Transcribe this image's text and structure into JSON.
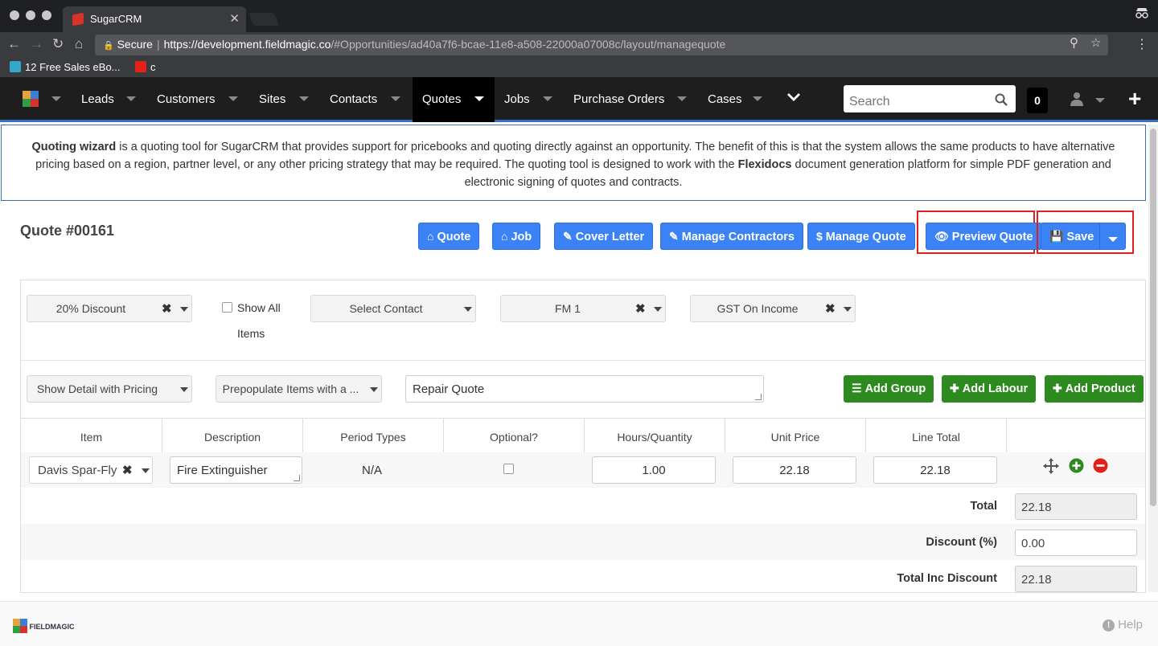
{
  "browser": {
    "tab_title": "SugarCRM",
    "tab_close": "✕",
    "omnibox": {
      "secure_label": "Secure",
      "separator": "|",
      "host": "https://development.fieldmagic.co",
      "path": "/#Opportunities/ad40a7f6-bcae-11e8-a508-22000a07008c/layout/managequote"
    },
    "bookmarks": [
      {
        "label": "12 Free Sales eBo...",
        "icon": "bookmark-icon",
        "color": "#35a7c9"
      },
      {
        "label": "c",
        "icon": "youtube-icon",
        "color": "#e62117"
      }
    ]
  },
  "navbar": {
    "items": [
      {
        "label": "Leads"
      },
      {
        "label": "Customers"
      },
      {
        "label": "Sites"
      },
      {
        "label": "Contacts"
      },
      {
        "label": "Quotes",
        "active": true
      },
      {
        "label": "Jobs"
      },
      {
        "label": "Purchase Orders"
      },
      {
        "label": "Cases"
      }
    ],
    "search_placeholder": "Search",
    "notification_count": "0",
    "accent_color": "#3a6fbf"
  },
  "banner": {
    "part1_bold": "Quoting wizard",
    "part1": " is a quoting tool for SugarCRM that provides support for pricebooks and quoting directly against an opportunity. The benefit of this is that the system allows the same products to have alternative pricing based on a region, partner level, or any other pricing strategy that may be required. The quoting tool is designed to work with the ",
    "part2_bold": "Flexidocs",
    "part2": " document generation platform for simple PDF generation and electronic signing of quotes and contracts."
  },
  "quote": {
    "title": "Quote #00161",
    "actions": {
      "quote": "Quote",
      "job": "Job",
      "cover_letter": "Cover Letter",
      "manage_contractors": "Manage Contractors",
      "manage_quote": "Manage Quote",
      "preview_quote": "Preview Quote",
      "save": "Save"
    },
    "filters": {
      "discount": "20% Discount",
      "show_all_items_line1": "Show All",
      "show_all_items_line2": "Items",
      "contact": "Select Contact",
      "fm": "FM 1",
      "tax": "GST On Income",
      "detail": "Show Detail with Pricing",
      "prepopulate": "Prepopulate Items with a ...",
      "quote_name": "Repair Quote"
    },
    "add_buttons": {
      "group": "Add Group",
      "labour": "Add Labour",
      "product": "Add Product"
    },
    "table": {
      "headers": [
        "Item",
        "Description",
        "Period Types",
        "Optional?",
        "Hours/Quantity",
        "Unit Price",
        "Line Total"
      ],
      "rows": [
        {
          "item": "Davis Spar-Fly",
          "description": "Fire Extinguisher",
          "period_type": "N/A",
          "optional": false,
          "quantity": "1.00",
          "unit_price": "22.18",
          "line_total": "22.18"
        }
      ]
    },
    "summary": {
      "total_label": "Total",
      "total_value": "22.18",
      "discount_label": "Discount (%)",
      "discount_value": "0.00",
      "total_inc_label": "Total Inc Discount",
      "total_inc_value": "22.18"
    }
  },
  "footer": {
    "brand": "FIELDMAGIC",
    "help": "Help"
  },
  "colors": {
    "primary_blue": "#3b82f6",
    "success_green": "#2d8a1f",
    "highlight_red": "#e02020",
    "navbar_bg": "#1e1e1e"
  }
}
